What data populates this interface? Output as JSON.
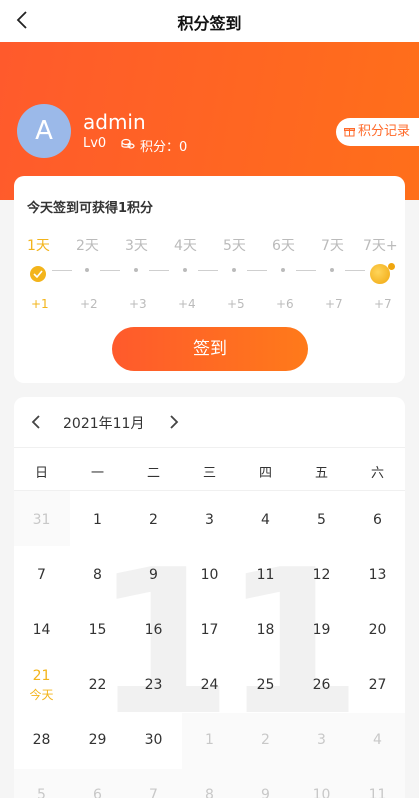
{
  "nav": {
    "title": "积分签到"
  },
  "profile": {
    "avatar_letter": "A",
    "username": "admin",
    "level": "Lv0",
    "points_label": "积分：0",
    "record_button": "积分记录"
  },
  "checkin": {
    "tip": "今天签到可获得1积分",
    "days": [
      "1天",
      "2天",
      "3天",
      "4天",
      "5天",
      "6天",
      "7天",
      "7天+"
    ],
    "rewards": [
      "+1",
      "+2",
      "+3",
      "+4",
      "+5",
      "+6",
      "+7",
      "+7"
    ],
    "sign_button": "签到"
  },
  "calendar": {
    "month_label": "2021年11月",
    "watermark": "11",
    "weekdays": [
      "日",
      "一",
      "二",
      "三",
      "四",
      "五",
      "六"
    ],
    "today_label": "今天",
    "rows": [
      [
        "31",
        "1",
        "2",
        "3",
        "4",
        "5",
        "6"
      ],
      [
        "7",
        "8",
        "9",
        "10",
        "11",
        "12",
        "13"
      ],
      [
        "14",
        "15",
        "16",
        "17",
        "18",
        "19",
        "20"
      ],
      [
        "21",
        "22",
        "23",
        "24",
        "25",
        "26",
        "27"
      ],
      [
        "28",
        "29",
        "30",
        "1",
        "2",
        "3",
        "4"
      ],
      [
        "5",
        "6",
        "7",
        "8",
        "9",
        "10",
        "11"
      ]
    ]
  },
  "colors": {
    "accent": "#ff6a2a",
    "gold": "#f3b41b"
  }
}
